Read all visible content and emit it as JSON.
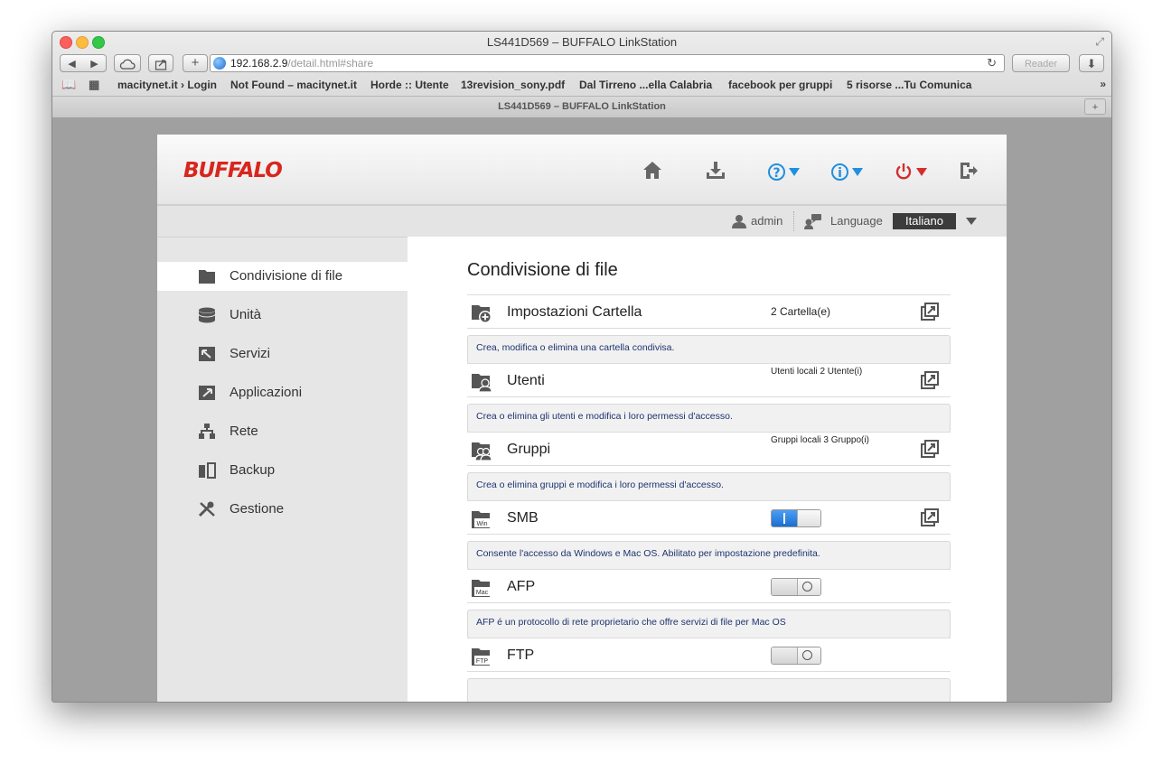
{
  "window": {
    "title": "LS441D569 – BUFFALO LinkStation"
  },
  "toolbar": {
    "url_host": "192.168.2.9",
    "url_path": "/detail.html#share",
    "reader_label": "Reader"
  },
  "bookmarks": [
    "macitynet.it › Login",
    "Not Found – macitynet.it",
    "Horde :: Utente",
    "13revision_sony.pdf",
    "Dal Tirreno ...ella Calabria",
    "facebook per gruppi",
    "5 risorse ...Tu Comunica"
  ],
  "tab": {
    "label": "LS441D569 – BUFFALO LinkStation"
  },
  "page": {
    "logo": "BUFFALO",
    "user": "admin",
    "language_label": "Language",
    "language_value": "Italiano"
  },
  "sidebar": {
    "items": [
      {
        "label": "Condivisione di file",
        "icon": "folder-icon",
        "active": true
      },
      {
        "label": "Unità",
        "icon": "drive-icon"
      },
      {
        "label": "Servizi",
        "icon": "services-icon"
      },
      {
        "label": "Applicazioni",
        "icon": "applications-icon"
      },
      {
        "label": "Rete",
        "icon": "network-icon"
      },
      {
        "label": "Backup",
        "icon": "backup-icon"
      },
      {
        "label": "Gestione",
        "icon": "tools-icon"
      }
    ]
  },
  "main": {
    "title": "Condivisione di file",
    "rows": [
      {
        "label": "Impostazioni Cartella",
        "value": "2 Cartella(e)",
        "desc": "Crea, modifica o elimina una cartella condivisa.",
        "icon": "folder-add-icon"
      },
      {
        "label": "Utenti",
        "value": "Utenti locali 2 Utente(i)",
        "desc": "Crea o elimina gli utenti e modifica i loro permessi d'accesso.",
        "icon": "user-folder-icon"
      },
      {
        "label": "Gruppi",
        "value": "Gruppi locali 3 Gruppo(i)",
        "desc": "Crea o elimina gruppi e modifica i loro permessi d'accesso.",
        "icon": "group-folder-icon"
      },
      {
        "label": "SMB",
        "toggle": "on",
        "desc": "Consente l'accesso da Windows e Mac OS. Abilitato per impostazione predefinita.",
        "icon": "win-folder-icon",
        "icon_text": "Win"
      },
      {
        "label": "AFP",
        "toggle": "off",
        "desc": "AFP é un protocollo di rete proprietario che offre servizi di file per Mac OS",
        "icon": "mac-folder-icon",
        "icon_text": "Mac"
      },
      {
        "label": "FTP",
        "toggle": "off",
        "desc": "",
        "icon": "ftp-folder-icon",
        "icon_text": "FTP"
      }
    ]
  },
  "colors": {
    "brand": "#d8261e",
    "accent": "#1a6ecf",
    "help": "#1f8fe0",
    "power": "#d22f2f"
  }
}
